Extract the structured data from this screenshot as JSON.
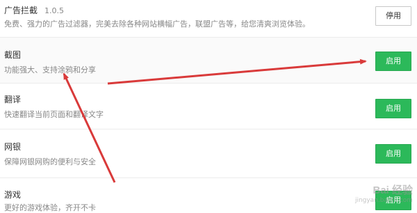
{
  "extensions": [
    {
      "name": "广告拦截",
      "version": "1.0.5",
      "description": "免费、强力的广告过滤器，完美去除各种网站横幅广告，联盟广告等，给您清爽浏览体验。",
      "button": "停用",
      "enabled": true
    },
    {
      "name": "截图",
      "description": "功能强大、支持涂鸦和分享",
      "button": "启用",
      "enabled": false
    },
    {
      "name": "翻译",
      "description": "快速翻译当前页面和翻译文字",
      "button": "启用",
      "enabled": false
    },
    {
      "name": "网银",
      "description": "保障网银网购的便利与安全",
      "button": "启用",
      "enabled": false
    },
    {
      "name": "游戏",
      "description": "更好的游戏体验，齐开不卡",
      "button": "启用",
      "enabled": false
    }
  ],
  "watermark": {
    "logo": "Bai 经验",
    "site": "jingyan.baidu.com"
  },
  "colors": {
    "enable_green": "#2cb95a",
    "arrow_red": "#d93a3a"
  }
}
